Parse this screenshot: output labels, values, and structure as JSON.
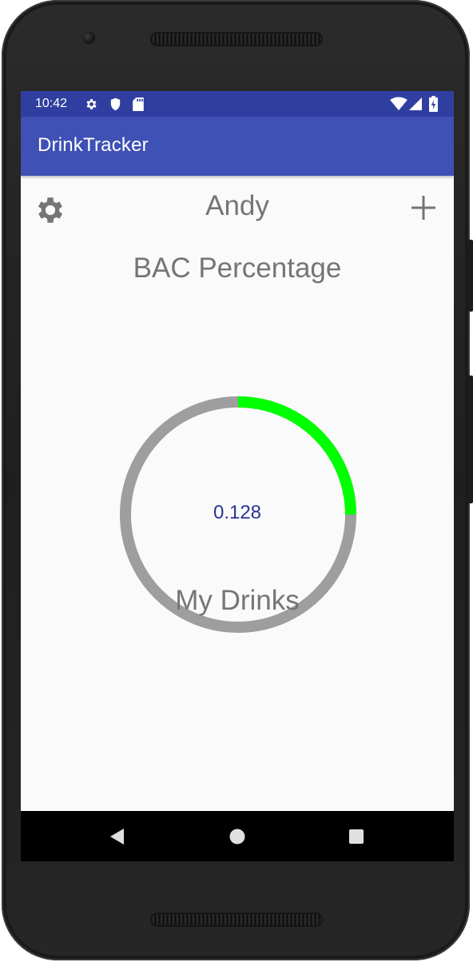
{
  "status_bar": {
    "time": "10:42",
    "icons": [
      "settings-icon",
      "shield-icon",
      "sd-card-icon",
      "wifi-icon",
      "signal-icon",
      "battery-icon"
    ]
  },
  "app_bar": {
    "title": "DrinkTracker"
  },
  "header": {
    "user_name": "Andy",
    "settings_icon": "gear-icon",
    "add_icon": "plus-icon"
  },
  "bac": {
    "title": "BAC Percentage",
    "value": "0.128",
    "progress_fraction": 0.25
  },
  "drinks": {
    "title": "My Drinks"
  },
  "nav_bar": {
    "icons": [
      "back-icon",
      "home-icon",
      "recents-icon"
    ]
  },
  "colors": {
    "status_bar": "#303f9f",
    "app_bar": "#3f51b5",
    "gauge_track": "#9e9e9e",
    "gauge_progress": "#00ff00",
    "value_text": "#283593",
    "muted_text": "#757575"
  }
}
